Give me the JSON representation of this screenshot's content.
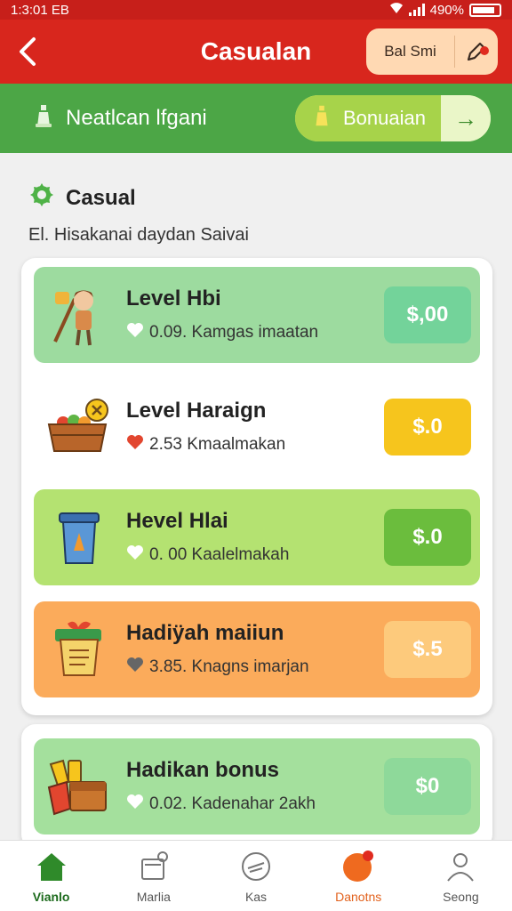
{
  "status_bar": {
    "time": "1:3:01 EB",
    "battery": "490%"
  },
  "app_bar": {
    "title": "Casualan",
    "pill_label": "Bal Smi"
  },
  "promo_bar": {
    "label": "Neatlcan lfgani",
    "button_label": "Bonuaian"
  },
  "section": {
    "title": "Casual",
    "subtitle": "El. Hisakanai daydan Saivai"
  },
  "items": [
    {
      "title": "Level Hbi",
      "meta": "0.09. Kamgas imaatan",
      "price": "$,00",
      "row_color": "#9ddb9f",
      "price_color": "#73d39a",
      "heart_color": "#ffffff",
      "icon": "character-icon"
    },
    {
      "title": "Level Haraign",
      "meta": "2.53  Kmaalmakan",
      "price": "$.0",
      "row_color": "#ffffff",
      "price_color": "#f6c51d",
      "heart_color": "#e2462f",
      "icon": "food-basket-icon"
    },
    {
      "title": "Hevel Hlai",
      "meta": "0. 00  Kaalelmakah",
      "price": "$.0",
      "row_color": "#b4e271",
      "price_color": "#6bbd3d",
      "heart_color": "#ffffff",
      "icon": "trash-bin-icon"
    },
    {
      "title": "Hadiÿah maiiun",
      "meta": "3.85. Knagns imarjan",
      "price": "$.5",
      "row_color": "#fbab5b",
      "price_color": "#fdca7c",
      "heart_color": "#666666",
      "icon": "gift-scroll-icon"
    },
    {
      "title": "Hadikan bonus",
      "meta": "0.02. Kadenahar 2akh",
      "price": "$0",
      "row_color": "#a4e09d",
      "price_color": "#8ed99a",
      "heart_color": "#ffffff",
      "icon": "treasure-chest-icon"
    }
  ],
  "bottom_nav": [
    {
      "label": "Vianlo",
      "icon": "home-icon",
      "state": "active"
    },
    {
      "label": "Marlia",
      "icon": "store-icon",
      "state": "normal"
    },
    {
      "label": "Kas",
      "icon": "compass-icon",
      "state": "normal"
    },
    {
      "label": "Danotns",
      "icon": "orange-ball-icon",
      "state": "orange"
    },
    {
      "label": "Seong",
      "icon": "profile-icon",
      "state": "normal"
    }
  ],
  "colors": {
    "app_bar": "#d8261d",
    "promo_bar": "#4ca646",
    "accent_green": "#1d6b1d"
  }
}
